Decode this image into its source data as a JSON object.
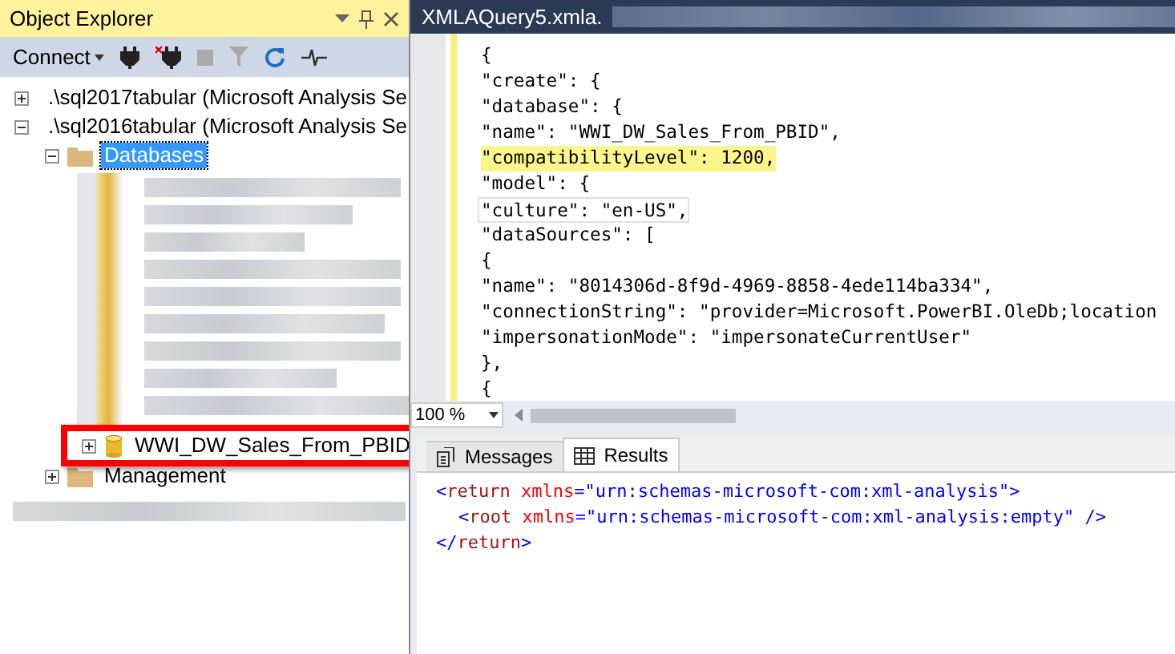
{
  "object_explorer": {
    "title": "Object Explorer",
    "connect_label": "Connect",
    "tree": [
      {
        "label": ".\\sql2017tabular (Microsoft Analysis Se",
        "kind": "server",
        "expanded": false,
        "selected": false
      },
      {
        "label": ".\\sql2016tabular (Microsoft Analysis Se",
        "kind": "server",
        "expanded": true,
        "selected": false,
        "children": [
          {
            "label": "Databases",
            "kind": "folder",
            "expanded": true,
            "selected": true,
            "children": [
              {
                "label": "WWI_DW_Sales_From_PBID",
                "kind": "database",
                "expanded": false,
                "selected": false,
                "highlighted": true
              }
            ]
          },
          {
            "label": "Management",
            "kind": "folder",
            "expanded": false,
            "selected": false
          }
        ]
      }
    ]
  },
  "editor": {
    "tab_title": "XMLAQuery5.xmla.",
    "lines": [
      {
        "text": "{",
        "highlighted": false,
        "current": false
      },
      {
        "text": "\"create\": {",
        "highlighted": false,
        "current": false
      },
      {
        "text": "\"database\": {",
        "highlighted": false,
        "current": false
      },
      {
        "text": "\"name\": \"WWI_DW_Sales_From_PBID\",",
        "highlighted": false,
        "current": false
      },
      {
        "text": "\"compatibilityLevel\": 1200,",
        "highlighted": true,
        "current": false
      },
      {
        "text": "\"model\": {",
        "highlighted": false,
        "current": false
      },
      {
        "text": "\"culture\": \"en-US\",",
        "highlighted": false,
        "current": true
      },
      {
        "text": "\"dataSources\": [",
        "highlighted": false,
        "current": false
      },
      {
        "text": "{",
        "highlighted": false,
        "current": false
      },
      {
        "text": "\"name\": \"8014306d-8f9d-4969-8858-4ede114ba334\",",
        "highlighted": false,
        "current": false
      },
      {
        "text": "\"connectionString\": \"provider=Microsoft.PowerBI.OleDb;location",
        "highlighted": false,
        "current": false
      },
      {
        "text": "\"impersonationMode\": \"impersonateCurrentUser\"",
        "highlighted": false,
        "current": false
      },
      {
        "text": "},",
        "highlighted": false,
        "current": false
      },
      {
        "text": "{",
        "highlighted": false,
        "current": false
      }
    ],
    "zoom": "100 %"
  },
  "results_pane": {
    "tabs": [
      {
        "label": "Messages",
        "kind": "messages",
        "selected": false
      },
      {
        "label": "Results",
        "kind": "grid",
        "selected": true
      }
    ],
    "lines": [
      {
        "indented": false,
        "tokens": [
          {
            "text": "<",
            "kind": "bracket"
          },
          {
            "text": "return",
            "kind": "tag"
          },
          {
            "text": " xmlns",
            "kind": "attr"
          },
          {
            "text": "=\"",
            "kind": "bracket"
          },
          {
            "text": "urn:schemas-microsoft-com:xml-analysis",
            "kind": "value"
          },
          {
            "text": "\">",
            "kind": "bracket"
          }
        ]
      },
      {
        "indented": true,
        "tokens": [
          {
            "text": "<",
            "kind": "bracket"
          },
          {
            "text": "root",
            "kind": "tag"
          },
          {
            "text": " xmlns",
            "kind": "attr"
          },
          {
            "text": "=\"",
            "kind": "bracket"
          },
          {
            "text": "urn:schemas-microsoft-com:xml-analysis:empty",
            "kind": "value"
          },
          {
            "text": "\" />",
            "kind": "bracket"
          }
        ]
      },
      {
        "indented": false,
        "tokens": [
          {
            "text": "</",
            "kind": "bracket"
          },
          {
            "text": "return",
            "kind": "tag"
          },
          {
            "text": ">",
            "kind": "bracket"
          }
        ]
      }
    ]
  }
}
